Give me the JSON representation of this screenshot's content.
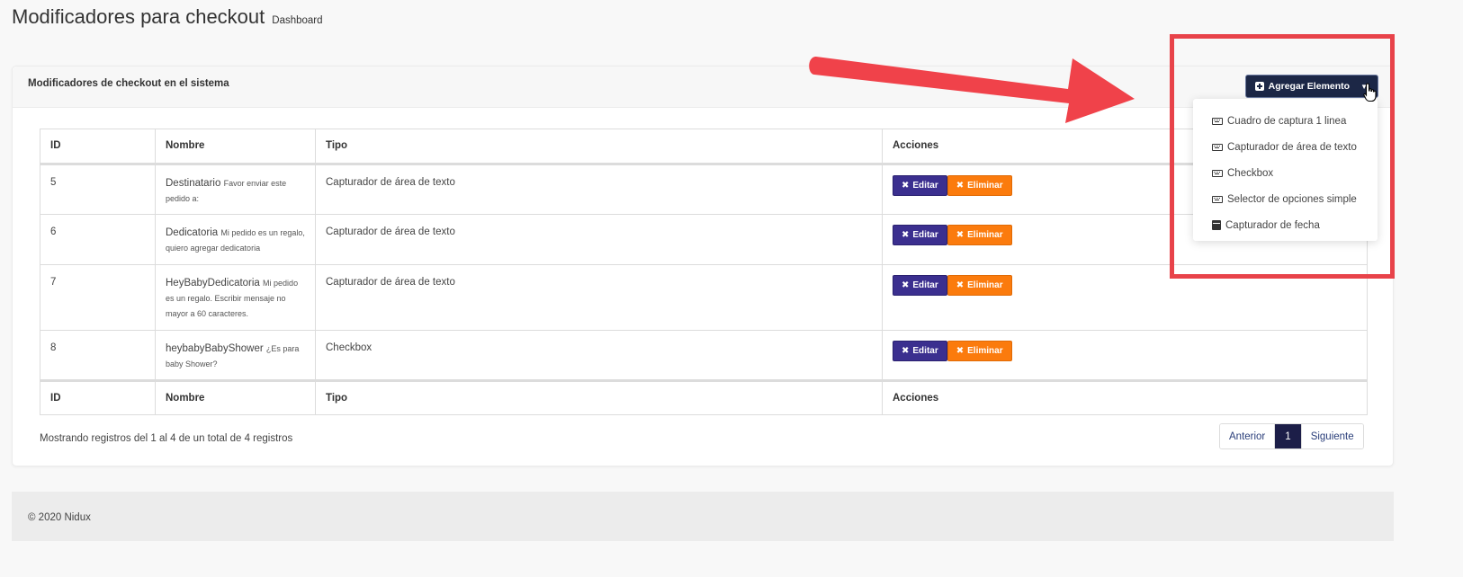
{
  "header": {
    "title": "Modificadores para checkout",
    "subtitle": "Dashboard"
  },
  "card": {
    "title": "Modificadores de checkout en el sistema",
    "add_button_label": "Agregar Elemento"
  },
  "table": {
    "headers": [
      "ID",
      "Nombre",
      "Tipo",
      "Acciones"
    ],
    "rows": [
      {
        "id": "5",
        "name": "Destinatario",
        "desc": "Favor enviar este pedido a:",
        "type": "Capturador de área de texto"
      },
      {
        "id": "6",
        "name": "Dedicatoria",
        "desc": "Mi pedido es un regalo, quiero agregar dedicatoria",
        "type": "Capturador de área de texto"
      },
      {
        "id": "7",
        "name": "HeyBabyDedicatoria",
        "desc": "Mi pedido es un regalo. Escribir mensaje no mayor a 60 caracteres.",
        "type": "Capturador de área de texto"
      },
      {
        "id": "8",
        "name": "heybabyBabyShower",
        "desc": "¿Es para baby Shower?",
        "type": "Checkbox"
      }
    ],
    "edit_label": "Editar",
    "delete_label": "Eliminar"
  },
  "records_info": "Mostrando registros del 1 al 4 de un total de 4 registros",
  "pagination": {
    "prev": "Anterior",
    "current": "1",
    "next": "Siguiente"
  },
  "footer": {
    "text": "© 2020 Nidux"
  },
  "dropdown": {
    "items": [
      {
        "label": "Cuadro de captura 1 linea",
        "icon": "keyboard-icon"
      },
      {
        "label": "Capturador de área de texto",
        "icon": "keyboard-icon"
      },
      {
        "label": "Checkbox",
        "icon": "keyboard-icon"
      },
      {
        "label": "Selector de opciones simple",
        "icon": "keyboard-icon"
      },
      {
        "label": "Capturador de fecha",
        "icon": "calendar-icon"
      }
    ]
  },
  "colors": {
    "primary_dark": "#1c2746",
    "edit": "#3b2f8f",
    "delete": "#fb7b0d",
    "annotation": "#e8434a"
  }
}
